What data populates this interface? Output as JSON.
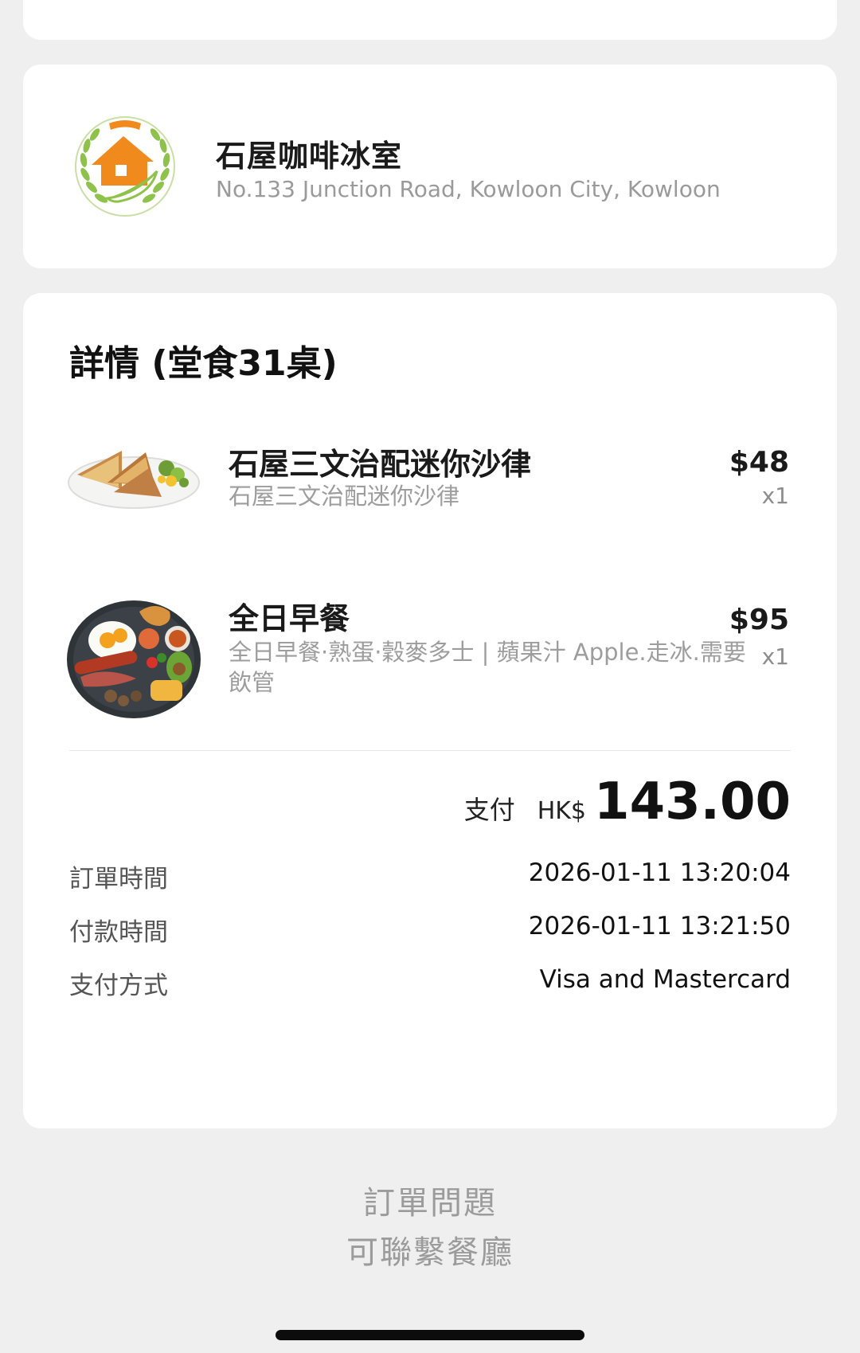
{
  "restaurant": {
    "name": "石屋咖啡冰室",
    "address": "No.133 Junction Road, Kowloon City, Kowloon"
  },
  "details": {
    "title": "詳情 (堂食31桌)",
    "items": [
      {
        "name": "石屋三文治配迷你沙律",
        "description": "石屋三文治配迷你沙律",
        "price": "$48",
        "qty": "x1"
      },
      {
        "name": "全日早餐",
        "description": "全日早餐·熟蛋·穀麥多士 | 蘋果汁 Apple.走冰.需要飲管",
        "price": "$95",
        "qty": "x1"
      }
    ],
    "payment": {
      "label": "支付",
      "currency": "HK$",
      "amount": "143.00"
    },
    "info": [
      {
        "label": "訂單時間",
        "value": "2026-01-11 13:20:04"
      },
      {
        "label": "付款時間",
        "value": "2026-01-11 13:21:50"
      },
      {
        "label": "支付方式",
        "value": "Visa and Mastercard"
      }
    ]
  },
  "footer": {
    "line1": "訂單問題",
    "line2": "可聯繫餐廳"
  },
  "colors": {
    "background": "#efefef",
    "card": "#ffffff",
    "logo_orange": "#f08a1c",
    "logo_green": "#8fc24a"
  },
  "icons": {
    "logo": "restaurant-logo-house",
    "item1": "sandwich-salad-photo",
    "item2": "all-day-breakfast-photo"
  }
}
